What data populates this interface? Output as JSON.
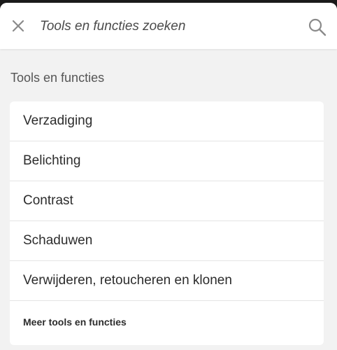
{
  "search": {
    "placeholder": "Tools en functies zoeken"
  },
  "section": {
    "title": "Tools en functies"
  },
  "items": [
    {
      "label": "Verzadiging"
    },
    {
      "label": "Belichting"
    },
    {
      "label": "Contrast"
    },
    {
      "label": "Schaduwen"
    },
    {
      "label": "Verwijderen, retoucheren en klonen"
    }
  ],
  "more": {
    "label": "Meer tools en functies"
  },
  "colors": {
    "background": "#f2f2f2",
    "card": "#ffffff",
    "text": "#2c2c2c",
    "icon": "#8a8a8a"
  }
}
